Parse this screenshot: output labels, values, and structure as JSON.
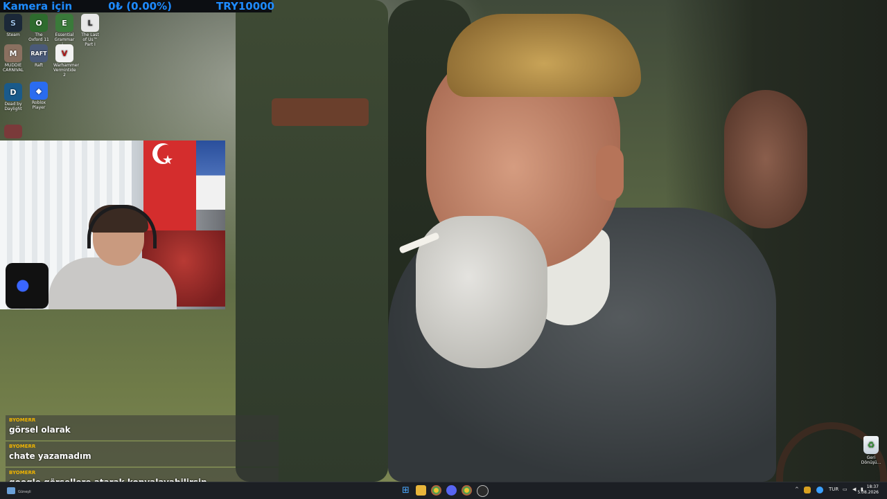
{
  "overlay_top": {
    "title": "Kamera için",
    "balance": "0₺ (0.00%)",
    "goal": "TRY10000"
  },
  "desktop_icons": [
    {
      "label": "Steam",
      "icon": "steam-icon",
      "color": "#1b2838"
    },
    {
      "label": "The Oxford 11",
      "icon": "book-icon",
      "color": "#2e6b2e"
    },
    {
      "label": "Essential Grammar i...",
      "icon": "book-icon",
      "color": "#3a7a3a"
    },
    {
      "label": "The Last of Us™ Part I",
      "icon": "game-icon",
      "color": "#e8e8e8"
    },
    {
      "label": "MUDDIE CARNIVAL",
      "icon": "game-icon",
      "color": "#8a7060"
    },
    {
      "label": "Raft",
      "icon": "raft-icon",
      "color": "#4a5a78"
    },
    {
      "label": "Warhammer Vermintide 2",
      "icon": "vermintide-icon",
      "color": "#f2f2f2"
    },
    {
      "label": "Dead by Daylight",
      "icon": "dbd-icon",
      "color": "#1a5a8a"
    },
    {
      "label": "Roblox Player",
      "icon": "roblox-icon",
      "color": "#2a6cf0"
    }
  ],
  "chat": [
    {
      "user": "BYOMERR",
      "text": "görsel olarak"
    },
    {
      "user": "BYOMERR",
      "text": "chate yazamadım"
    },
    {
      "user": "BYOMERR",
      "text": "google görsellere atarak kopyalayabilirsin"
    }
  ],
  "recycle_bin": {
    "label": "Geri Dönüşü..."
  },
  "taskbar": {
    "weather": "Güneşli",
    "language": "TUR",
    "time": "18:37",
    "date": "5.08.2026"
  }
}
